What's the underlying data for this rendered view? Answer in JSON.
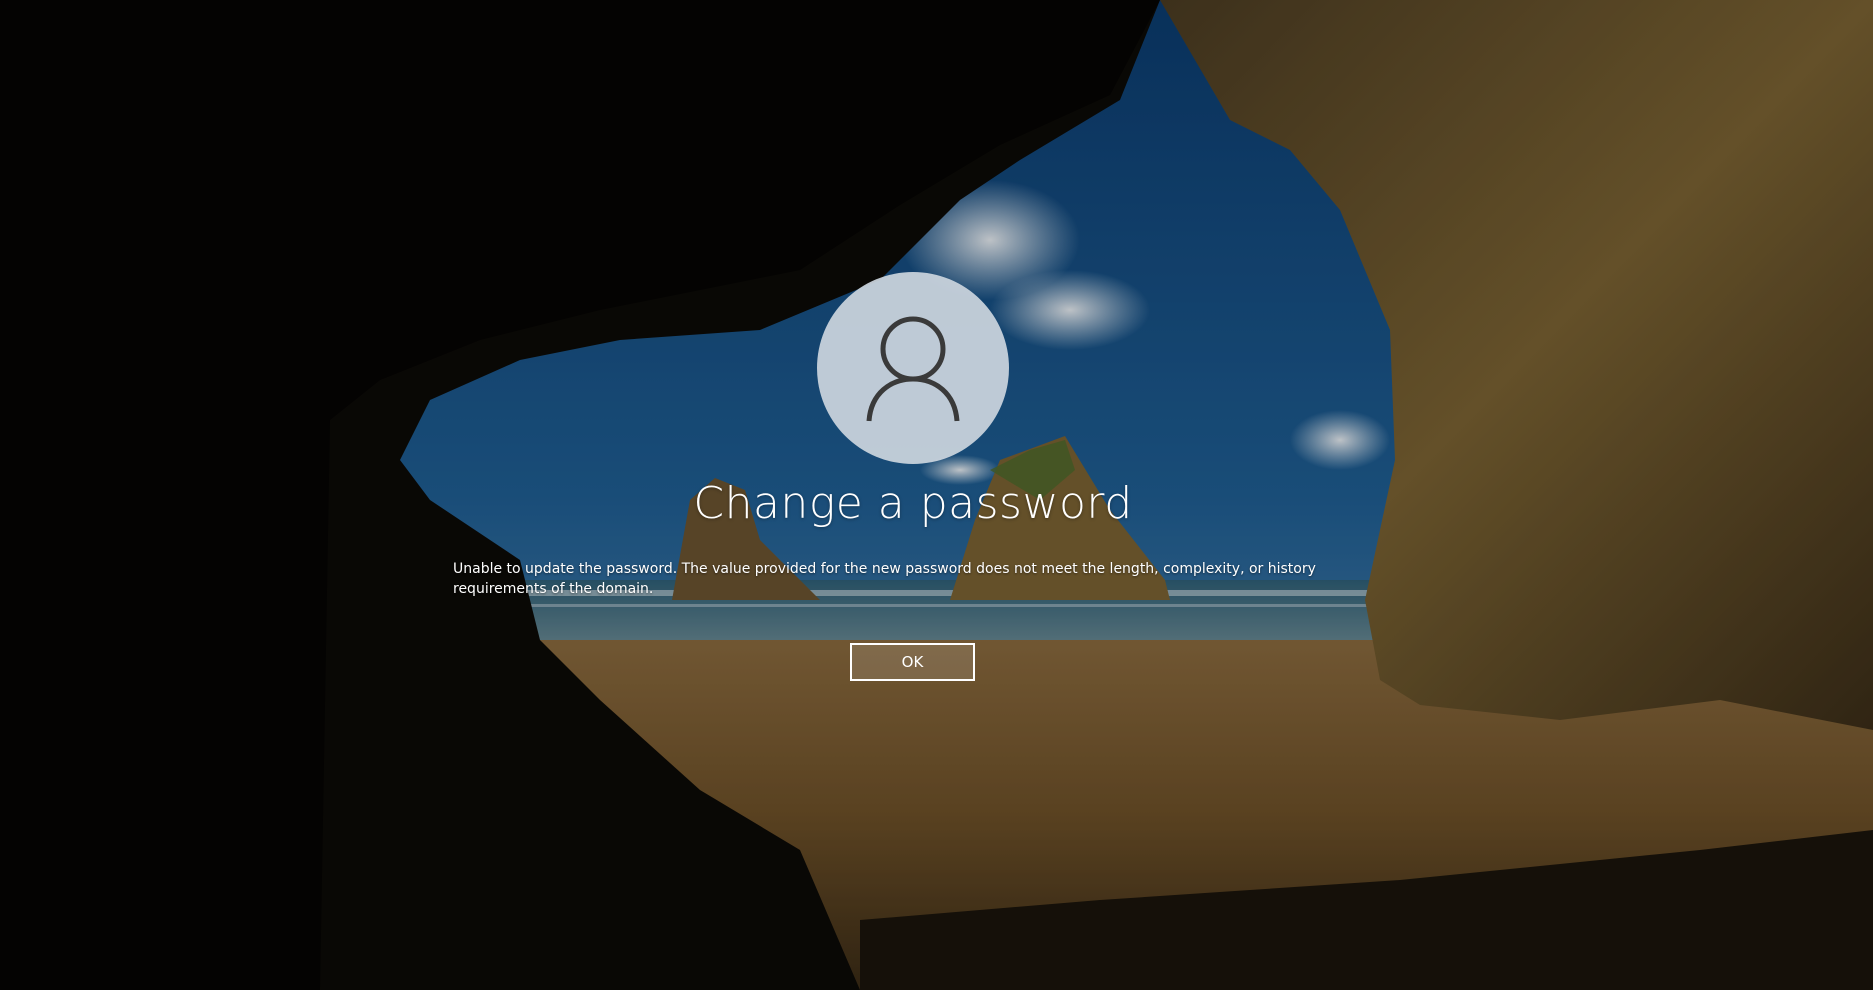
{
  "screen": {
    "title": "Change a password",
    "message": "Unable to update the password. The value provided for the new password does not meet the length, complexity, or history requirements of the domain.",
    "ok_label": "OK",
    "avatar_icon": "user-silhouette-icon"
  },
  "colors": {
    "text": "#ffffff",
    "avatar_bg": "#cdd6de",
    "avatar_icon": "#3a3a3a"
  }
}
